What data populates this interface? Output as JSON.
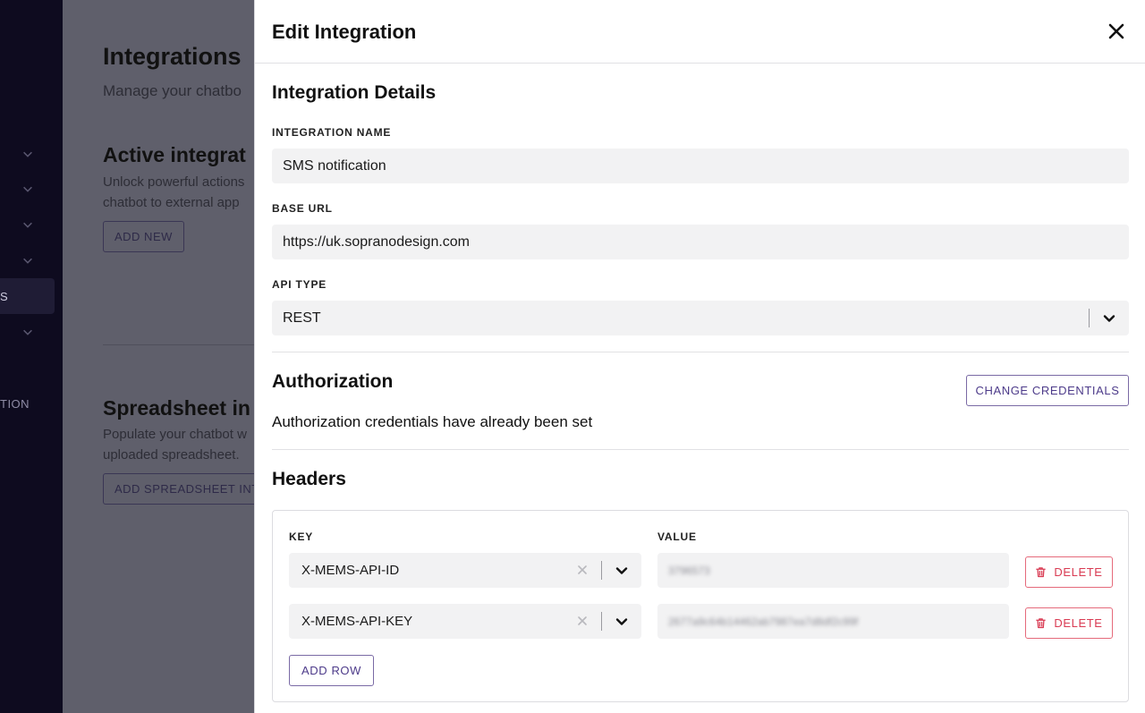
{
  "background": {
    "title": "Integrations",
    "subtitle": "Manage your chatbo",
    "active": {
      "heading": "Active integrat",
      "line1": "Unlock powerful actions",
      "line2": "chatbot to external app",
      "button": "ADD NEW"
    },
    "spreadsheet": {
      "heading": "Spreadsheet in",
      "line1": "Populate your chatbot w",
      "line2": "uploaded spreadsheet.",
      "button": "ADD SPREADSHEET INT"
    },
    "nav": {
      "active_item_fragment": "S",
      "item_fragment": "TION"
    }
  },
  "drawer": {
    "title": "Edit Integration",
    "details": {
      "heading": "Integration Details",
      "name_label": "INTEGRATION NAME",
      "name_value": "SMS notification",
      "url_label": "BASE URL",
      "url_value": "https://uk.sopranodesign.com",
      "api_label": "API TYPE",
      "api_value": "REST"
    },
    "authorization": {
      "heading": "Authorization",
      "change_button": "CHANGE CREDENTIALS",
      "status_text": "Authorization credentials have already been set"
    },
    "headers": {
      "heading": "Headers",
      "key_col": "KEY",
      "value_col": "VALUE",
      "rows": [
        {
          "key": "X-MEMS-API-ID",
          "value": "3796573",
          "delete": "DELETE"
        },
        {
          "key": "X-MEMS-API-KEY",
          "value": "2677a9c64b14462ab7987ea7d8df2c99f",
          "delete": "DELETE"
        }
      ],
      "add_row": "ADD ROW"
    }
  },
  "colors": {
    "accent": "#4d3b8a",
    "danger": "#d93b53",
    "nav_bg": "#0e0b1f",
    "overlay": "#5f5f6b"
  }
}
